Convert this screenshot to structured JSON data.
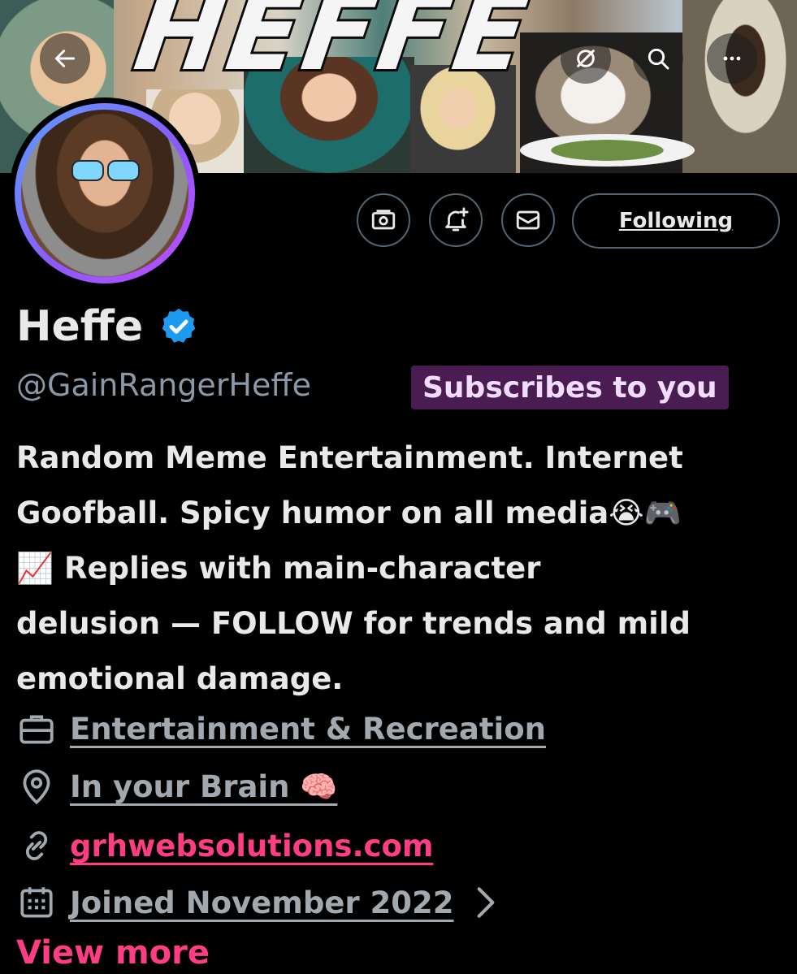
{
  "banner": {
    "title": "HEFFE"
  },
  "header_buttons": {
    "back_icon": "arrow-left-icon",
    "grok_icon": "slash-circle-icon",
    "search_icon": "search-icon",
    "more_icon": "more-dots-icon"
  },
  "actions": {
    "subscribe_icon": "money-icon",
    "notify_icon": "bell-plus-icon",
    "message_icon": "envelope-icon",
    "follow_label": "Following"
  },
  "profile": {
    "display_name": "Heffe",
    "verified_icon": "verified-badge-icon",
    "handle": "@GainRangerHeffe",
    "subscribes_badge": "Subscribes to you",
    "bio": "Random Meme Entertainment. Internet\nGoofball. Spicy humor on all media😭🎮\n📈 Replies with main-character\ndelusion — FOLLOW for trends and mild\nemotional damage."
  },
  "meta": {
    "category": "Entertainment & Recreation",
    "location": "In your Brain 🧠",
    "website": "grhwebsolutions.com",
    "joined": "Joined November 2022"
  },
  "view_more": "View more",
  "colors": {
    "accent": "#ff3d84",
    "badge_bg": "#4a1d52",
    "verified": "#1d9bf0",
    "muted": "#8b98a5"
  }
}
